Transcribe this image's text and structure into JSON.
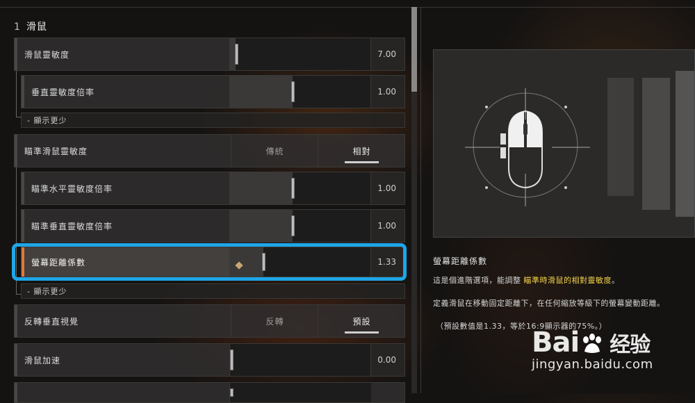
{
  "section": {
    "number": "1",
    "title": "滑鼠"
  },
  "rows": {
    "mouse_sensitivity": {
      "label": "滑鼠靈敏度",
      "value": "7.00",
      "slider_fraction": 0.04
    },
    "vertical_multiplier": {
      "label": "垂直靈敏度倍率",
      "value": "1.00",
      "slider_fraction": 0.44
    },
    "show_less_1": "- 顯示更少",
    "ads_sensitivity": {
      "label": "瞄準滑鼠靈敏度",
      "option_a": "傳統",
      "option_b": "相對",
      "selected": "相對"
    },
    "ads_horizontal": {
      "label": "瞄準水平靈敏度倍率",
      "value": "1.00",
      "slider_fraction": 0.44
    },
    "ads_vertical": {
      "label": "瞄準垂直靈敏度倍率",
      "value": "1.00",
      "slider_fraction": 0.44
    },
    "monitor_distance": {
      "label": "螢幕距離係數",
      "value": "1.33",
      "slider_fraction": 0.24
    },
    "show_less_2": "- 顯示更少",
    "invert_look": {
      "label": "反轉垂直視覺",
      "option_a": "反轉",
      "option_b": "預設",
      "selected": "預設"
    },
    "mouse_accel": {
      "label": "滑鼠加速",
      "value": "0.00",
      "slider_fraction": 0.0
    }
  },
  "detail": {
    "title": "螢幕距離係數",
    "line1_pre": "這是個進階選項，能調整",
    "line1_hl": "瞄準時滑鼠的相對靈敏度",
    "line1_post": "。",
    "line2": "定義滑鼠在移動固定距離下，在任何縮放等級下的螢幕變動距離。",
    "line3": "（預設數值是1.33，等於16:9顯示器的75%。）"
  },
  "watermark": {
    "logo_left": "Bai",
    "logo_right": "经验",
    "url": "jingyan.baidu.com"
  },
  "colors": {
    "highlight": "#1ea6e6",
    "emphasis_text": "#f2d24a"
  },
  "icons": [
    "mouse-diagram-icon",
    "paw-icon"
  ]
}
